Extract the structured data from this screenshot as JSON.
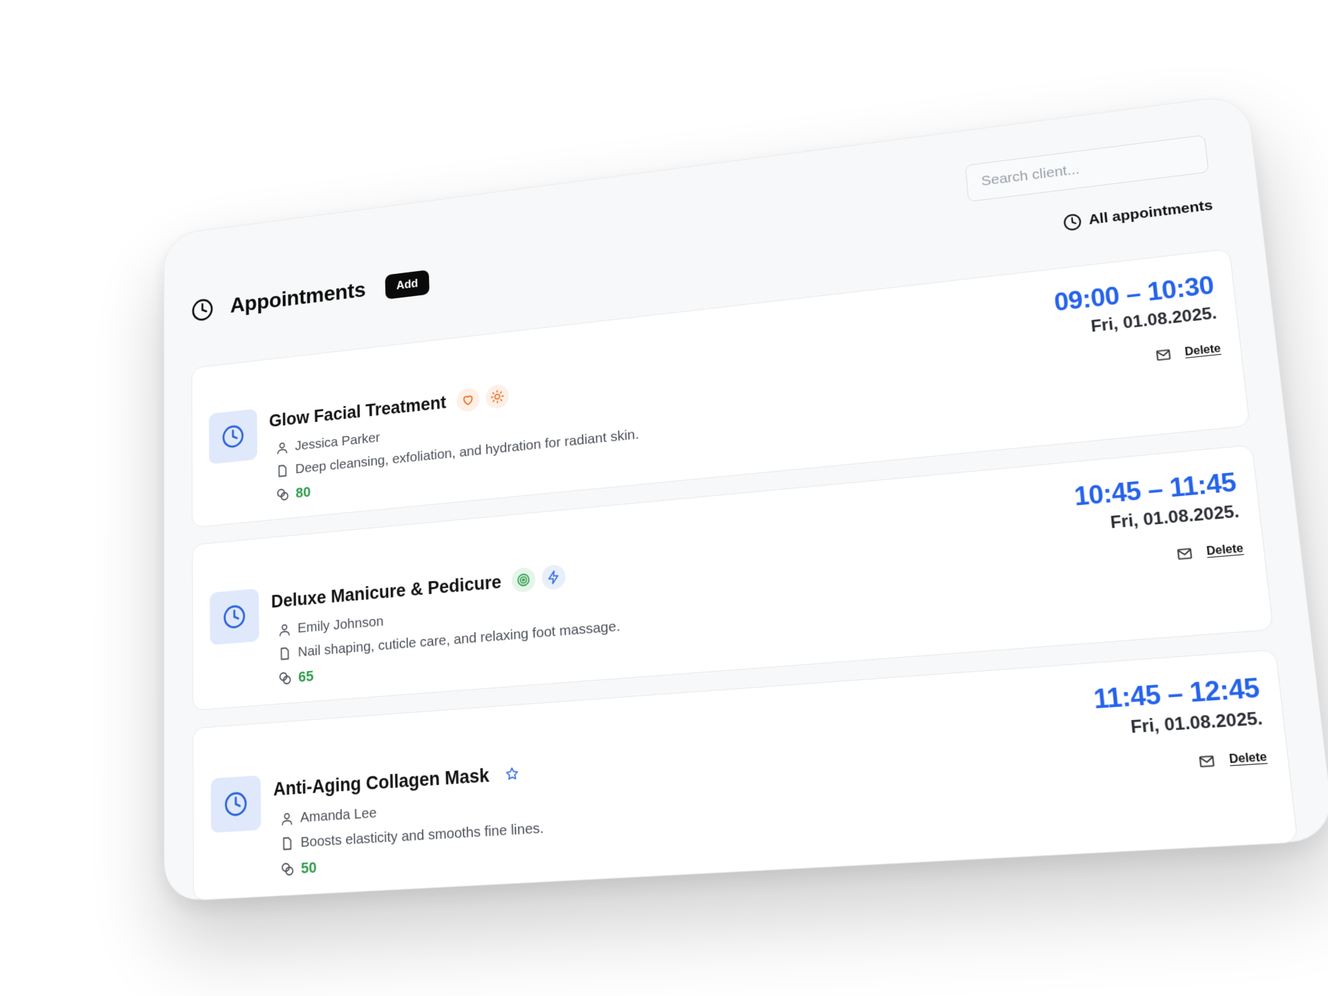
{
  "header": {
    "title": "Appointments",
    "add_label": "Add",
    "search_placeholder": "Search client...",
    "all_link": "All appointments"
  },
  "appointments": [
    {
      "title": "Glow Facial Treatment",
      "tags": [
        "heart-icon",
        "sun-icon"
      ],
      "client": "Jessica Parker",
      "description": "Deep cleansing, exfoliation, and hydration for radiant skin.",
      "points": "80",
      "time": "09:00 – 10:30",
      "date": "Fri, 01.08.2025.",
      "delete_label": "Delete"
    },
    {
      "title": "Deluxe Manicure & Pedicure",
      "tags": [
        "target-icon",
        "lightning-icon"
      ],
      "client": "Emily Johnson",
      "description": "Nail shaping, cuticle care, and relaxing foot massage.",
      "points": "65",
      "time": "10:45 – 11:45",
      "date": "Fri, 01.08.2025.",
      "delete_label": "Delete"
    },
    {
      "title": "Anti-Aging Collagen Mask",
      "tags": [
        "star-icon"
      ],
      "client": "Amanda Lee",
      "description": "Boosts elasticity and smooths fine lines.",
      "points": "50",
      "time": "11:45 – 12:45",
      "date": "Fri, 01.08.2025.",
      "delete_label": "Delete"
    }
  ],
  "colors": {
    "accent_blue": "#2563eb",
    "points_green": "#2e9d4b",
    "tag_orange": "#ea6a1a"
  }
}
